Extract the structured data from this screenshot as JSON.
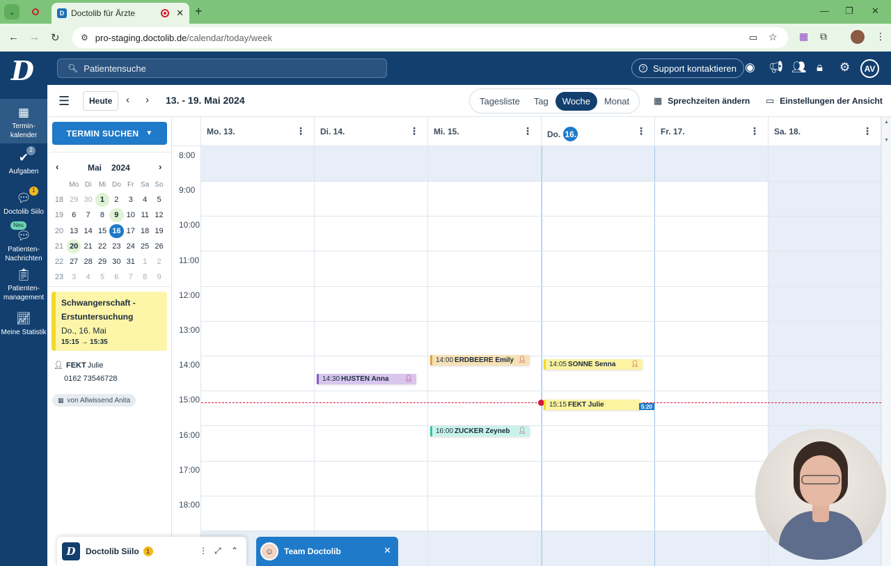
{
  "browser": {
    "tab_title": "Doctolib für Ärzte",
    "url_host": "pro-staging.doctolib.de",
    "url_path": "/calendar/today/week"
  },
  "header": {
    "logo": "D",
    "search_placeholder": "Patientensuche",
    "support_label": "Support kontaktieren",
    "avatar_initials": "AV"
  },
  "rail": {
    "items": [
      {
        "label": "Termin-\nkalender",
        "icon": "calendar-icon"
      },
      {
        "label": "Aufgaben",
        "icon": "check-icon",
        "badge": "2"
      },
      {
        "label": "Doctolib Siilo",
        "icon": "chat-icon",
        "badge": "1"
      },
      {
        "label": "Patienten-\nNachrichten",
        "icon": "message-icon",
        "tag": "Neu"
      },
      {
        "label": "Patienten-\nmanagement",
        "icon": "clipboard-icon"
      },
      {
        "label": "Meine Statistik",
        "icon": "chart-icon"
      }
    ]
  },
  "toolbar": {
    "today_label": "Heute",
    "date_range": "13. - 19. Mai 2024",
    "views": [
      "Tagesliste",
      "Tag",
      "Woche",
      "Monat"
    ],
    "selected_view": "Woche",
    "hours_label": "Sprechzeiten ändern",
    "view_settings_label": "Einstellungen der Ansicht"
  },
  "side": {
    "search_button": "TERMIN SUCHEN",
    "month": "Mai",
    "year": "2024",
    "weekdays": [
      "Mo",
      "Di",
      "Mi",
      "Do",
      "Fr",
      "Sa",
      "So"
    ],
    "weeks": [
      {
        "wk": "18",
        "days": [
          "29",
          "30",
          "1",
          "2",
          "3",
          "4",
          "5"
        ]
      },
      {
        "wk": "19",
        "days": [
          "6",
          "7",
          "8",
          "9",
          "10",
          "11",
          "12"
        ]
      },
      {
        "wk": "20",
        "days": [
          "13",
          "14",
          "15",
          "16",
          "17",
          "18",
          "19"
        ]
      },
      {
        "wk": "21",
        "days": [
          "20",
          "21",
          "22",
          "23",
          "24",
          "25",
          "26"
        ]
      },
      {
        "wk": "22",
        "days": [
          "27",
          "28",
          "29",
          "30",
          "31",
          "1",
          "2"
        ]
      },
      {
        "wk": "23",
        "days": [
          "3",
          "4",
          "5",
          "6",
          "7",
          "8",
          "9"
        ]
      }
    ],
    "appointment": {
      "title_line1": "Schwangerschaft -",
      "title_line2": "Erstuntersuchung",
      "date": "Do., 16. Mai",
      "time": "15:15 → 15:35"
    },
    "patient_last": "FEKT",
    "patient_first": "Julie",
    "phone": "0162 73546728",
    "booked_by": "von Allwissend Anita"
  },
  "calendar": {
    "days": [
      "Mo. 13.",
      "Di. 14.",
      "Mi. 15.",
      "Do.",
      "Fr. 17.",
      "Sa. 18."
    ],
    "today_number": "16.",
    "hours": [
      "8:00",
      "9:00",
      "10:00",
      "11:00",
      "12:00",
      "13:00",
      "14:00",
      "15:00",
      "16:00",
      "17:00",
      "18:00"
    ],
    "events": [
      {
        "time": "14:00",
        "name": "ERDBEERE Emily",
        "color": "#f7e1b5",
        "accent": "#e6a23c"
      },
      {
        "time": "14:30",
        "name": "HUSTEN Anna",
        "color": "#d8c6ee",
        "accent": "#8a5cc7"
      },
      {
        "time": "14:05",
        "name": "SONNE Senna",
        "color": "#fdf3a0",
        "accent": "#f4d82c"
      },
      {
        "time": "15:15",
        "name": "FEKT Julie",
        "color": "#fdf3a0",
        "accent": "#f4d82c"
      },
      {
        "time": "16:00",
        "name": "ZUCKER Zeyneb",
        "color": "#c9f3ea",
        "accent": "#2fc6a5"
      }
    ],
    "mini_event_label": "5:20"
  },
  "widgets": {
    "siilo_label": "Doctolib Siilo",
    "siilo_badge": "1",
    "team_label": "Team Doctolib"
  }
}
